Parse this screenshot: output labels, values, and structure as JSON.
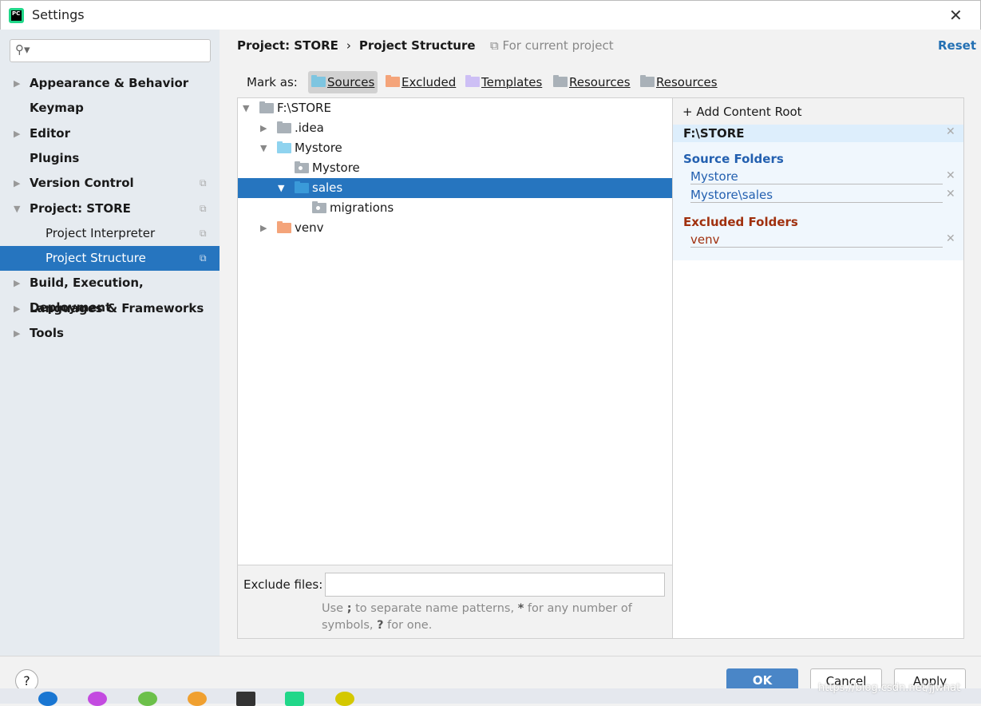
{
  "window": {
    "title": "Settings",
    "app_icon": "PC"
  },
  "search": {
    "placeholder": ""
  },
  "sidebar": {
    "items": [
      {
        "label": "Appearance & Behavior",
        "expandable": true
      },
      {
        "label": "Keymap"
      },
      {
        "label": "Editor",
        "expandable": true
      },
      {
        "label": "Plugins"
      },
      {
        "label": "Version Control",
        "expandable": true
      },
      {
        "label": "Project: STORE",
        "expanded": true
      },
      {
        "label": "Project Interpreter",
        "child": true
      },
      {
        "label": "Project Structure",
        "child": true,
        "selected": true
      },
      {
        "label": "Build, Execution, Deployment",
        "expandable": true
      },
      {
        "label": "Languages & Frameworks",
        "expandable": true
      },
      {
        "label": "Tools",
        "expandable": true
      }
    ]
  },
  "header": {
    "crumb1": "Project: STORE",
    "sep": "›",
    "crumb2": "Project Structure",
    "for_current": "For current project",
    "reset": "Reset"
  },
  "mark_as": {
    "label": "Mark as:",
    "buttons": [
      "Sources",
      "Excluded",
      "Templates",
      "Resources",
      "Resources"
    ],
    "colors": [
      "#7ec5e0",
      "#f4a47a",
      "#cdbff5",
      "#a9b1b8",
      "#a9b1b8"
    ]
  },
  "tree": [
    {
      "name": "F:\\STORE",
      "level": 0,
      "state": "expanded",
      "color": "#a9b1b8"
    },
    {
      "name": ".idea",
      "level": 1,
      "state": "collapsed",
      "color": "#a9b1b8"
    },
    {
      "name": "Mystore",
      "level": 1,
      "state": "expanded",
      "color": "#8fd3ef"
    },
    {
      "name": "Mystore",
      "level": 2,
      "state": "leaf",
      "color": "#a9b1b8",
      "package": true
    },
    {
      "name": "sales",
      "level": 2,
      "state": "expanded",
      "color": "#3a9ad9",
      "selected": true
    },
    {
      "name": "migrations",
      "level": 3,
      "state": "leaf",
      "color": "#a9b1b8",
      "package": true
    },
    {
      "name": "venv",
      "level": 1,
      "state": "collapsed",
      "color": "#f4a47a"
    }
  ],
  "exclude": {
    "label": "Exclude files:",
    "value": "",
    "hint_parts": [
      "Use ",
      ";",
      " to separate name patterns, ",
      "*",
      " for any number of symbols, ",
      "?",
      " for one."
    ]
  },
  "content_root": {
    "add": "Add Content Root",
    "root": "F:\\STORE",
    "source_title": "Source Folders",
    "sources": [
      "Mystore",
      "Mystore\\sales"
    ],
    "excluded_title": "Excluded Folders",
    "excluded": [
      "venv"
    ],
    "source_color": "#2360b0",
    "excluded_color": "#a0300e"
  },
  "footer": {
    "help": "?",
    "ok": "OK",
    "cancel": "Cancel",
    "apply": "Apply"
  },
  "watermark": "https://blog.csdn.net/jjwhat"
}
